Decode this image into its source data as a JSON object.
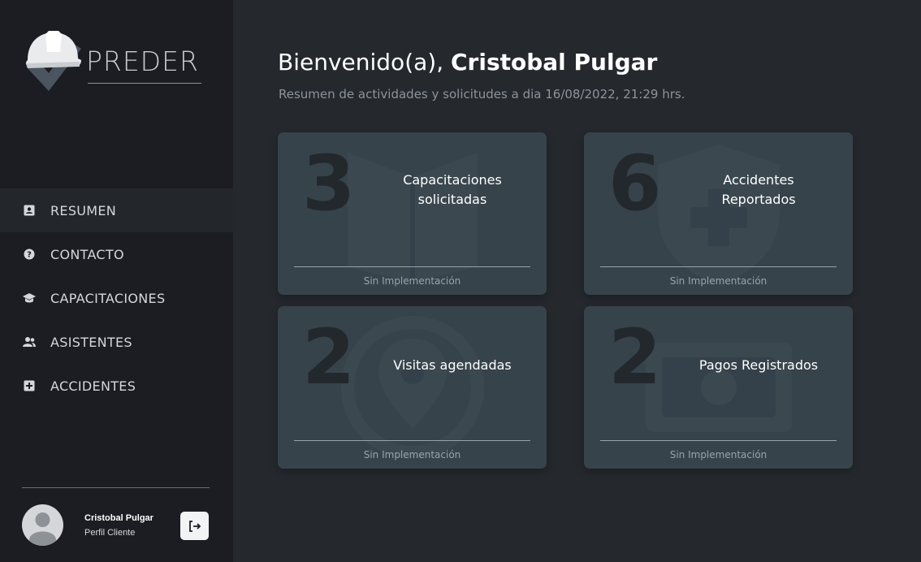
{
  "brand": {
    "name": "PREDER"
  },
  "nav": {
    "items": [
      {
        "label": "RESUMEN",
        "icon": "user-card-icon",
        "active": true
      },
      {
        "label": "CONTACTO",
        "icon": "question-circle-icon",
        "active": false
      },
      {
        "label": "CAPACITACIONES",
        "icon": "graduation-cap-icon",
        "active": false
      },
      {
        "label": "ASISTENTES",
        "icon": "users-icon",
        "active": false
      },
      {
        "label": "ACCIDENTES",
        "icon": "plus-square-icon",
        "active": false
      }
    ]
  },
  "user": {
    "name": "Cristobal Pulgar",
    "role": "Perfil Cliente",
    "logout_icon": "logout-icon"
  },
  "header": {
    "greeting_prefix": "Bienvenido(a), ",
    "greeting_name": "Cristobal Pulgar",
    "subtitle": "Resumen de actividades y solicitudes a dia 16/08/2022, 21:29 hrs."
  },
  "cards": [
    {
      "count": "3",
      "title": "Capacitaciones solicitadas",
      "footer": "Sin Implementación",
      "icon": "book-icon"
    },
    {
      "count": "6",
      "title": "Accidentes Reportados",
      "footer": "Sin Implementación",
      "icon": "shield-plus-icon"
    },
    {
      "count": "2",
      "title": "Visitas agendadas",
      "footer": "Sin Implementación",
      "icon": "map-pin-icon"
    },
    {
      "count": "2",
      "title": "Pagos Registrados",
      "footer": "Sin Implementación",
      "icon": "money-bill-icon"
    }
  ],
  "colors": {
    "sidebar_bg": "#1b1d22",
    "main_bg": "#25282d",
    "card_bg": "#37434b",
    "number_color": "#23282d"
  }
}
